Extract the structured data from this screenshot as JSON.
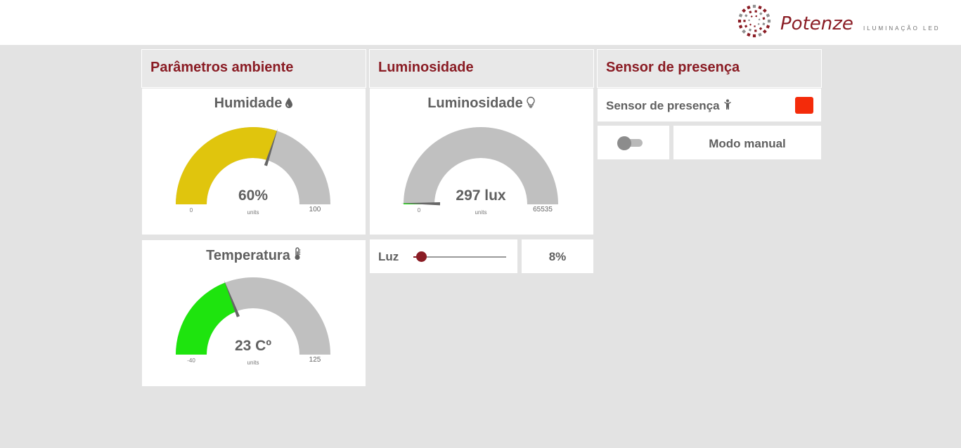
{
  "brand": {
    "name": "Potenze",
    "subtitle": "ILUMINAÇÃO LED"
  },
  "colors": {
    "accent": "#8a1c24",
    "gauge_track": "#c0c0c0",
    "humidity_fill": "#e0c50d",
    "temperature_fill": "#1ee40e",
    "lux_fill": "#1ee40e",
    "presence_indicator": "#f42b0a"
  },
  "columns": {
    "ambient": "Parâmetros ambiente",
    "luminosity": "Luminosidade",
    "presence": "Sensor de presença"
  },
  "gauges": {
    "humidity": {
      "title": "Humidade",
      "icon": "water-drop-icon",
      "value": 60,
      "display": "60%",
      "units": "units",
      "min": 0,
      "max": 100,
      "min_label": "0",
      "max_label": "100"
    },
    "temperature": {
      "title": "Temperatura",
      "icon": "thermometer-icon",
      "value": 23,
      "display": "23 Cº",
      "units": "units",
      "min": -40,
      "max": 125,
      "min_label": "-40",
      "max_label": "125"
    },
    "lux": {
      "title": "Luminosidade",
      "icon": "lightbulb-icon",
      "value": 297,
      "display": "297 lux",
      "units": "units",
      "min": 0,
      "max": 65535,
      "min_label": "0",
      "max_label": "65535"
    }
  },
  "light_control": {
    "label": "Luz",
    "value": 8,
    "display": "8%"
  },
  "presence": {
    "label": "Sensor de presença",
    "icon": "person-icon",
    "state": "detected"
  },
  "mode": {
    "toggle_on": false,
    "label": "Modo manual"
  }
}
